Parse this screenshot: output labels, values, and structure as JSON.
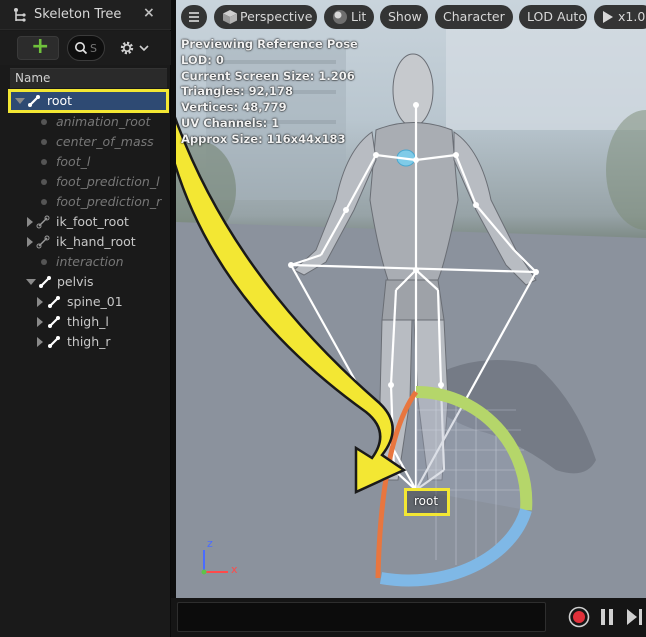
{
  "panel": {
    "title": "Skeleton Tree",
    "close_icon": "×",
    "add_icon": "+",
    "search_placeholder": "S",
    "column_header": "Name"
  },
  "tree": [
    {
      "label": "root",
      "style": "selected",
      "icon": "bone"
    },
    {
      "label": "animation_root",
      "style": "virtual",
      "icon": "dot"
    },
    {
      "label": "center_of_mass",
      "style": "virtual",
      "icon": "dot"
    },
    {
      "label": "foot_l",
      "style": "virtual",
      "icon": "dot"
    },
    {
      "label": "foot_prediction_l",
      "style": "virtual",
      "icon": "dot"
    },
    {
      "label": "foot_prediction_r",
      "style": "virtual",
      "icon": "dot"
    },
    {
      "label": "ik_foot_root",
      "style": "bone",
      "icon": "bone-outline"
    },
    {
      "label": "ik_hand_root",
      "style": "bone",
      "icon": "bone-outline"
    },
    {
      "label": "interaction",
      "style": "virtual",
      "icon": "dot"
    },
    {
      "label": "pelvis",
      "style": "bone",
      "icon": "bone"
    },
    {
      "label": "spine_01",
      "style": "bone",
      "icon": "bone"
    },
    {
      "label": "thigh_l",
      "style": "bone",
      "icon": "bone"
    },
    {
      "label": "thigh_r",
      "style": "bone",
      "icon": "bone"
    }
  ],
  "viewport": {
    "toolbar": {
      "menu_icon": "hamburger-icon",
      "perspective_label": "Perspective",
      "lit_label": "Lit",
      "show_label": "Show",
      "character_label": "Character",
      "lod_label": "LOD Auto",
      "play_label": "x1.0"
    },
    "info": [
      "Previewing Reference Pose",
      "LOD: 0",
      "Current Screen Size: 1.206",
      "Triangles: 92,178",
      "Vertices: 48,779",
      "UV Channels: 1",
      "Approx Size: 116x44x183"
    ],
    "root_label": "root",
    "axis": {
      "x": "x",
      "z": "z"
    }
  },
  "colors": {
    "highlight": "#f3e733",
    "selection": "#2e4a73",
    "accent_green": "#6fc13c",
    "gizmo_green": "#b5d66a",
    "gizmo_blue": "#7fb8e6",
    "gizmo_orange": "#e8763f"
  }
}
